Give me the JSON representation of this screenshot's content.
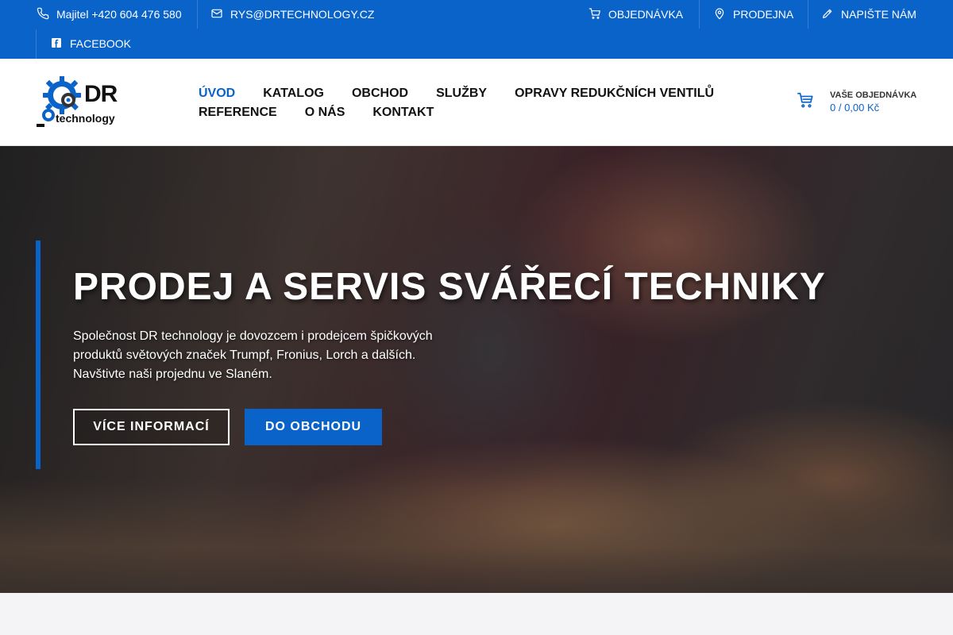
{
  "topbar": {
    "phone": "Majitel +420 604 476 580",
    "email": "RYS@DRTECHNOLOGY.CZ",
    "order": "OBJEDNÁVKA",
    "store": "PRODEJNA",
    "write": "NAPIŠTE NÁM",
    "facebook": "FACEBOOK"
  },
  "logo": {
    "dr": "DR",
    "technology": "technology"
  },
  "nav": {
    "row1": [
      "ÚVOD",
      "KATALOG",
      "OBCHOD",
      "SLUŽBY",
      "OPRAVY REDUKČNÍCH VENTILŮ"
    ],
    "row2": [
      "REFERENCE",
      "O NÁS",
      "KONTAKT"
    ]
  },
  "cart": {
    "title": "VAŠE OBJEDNÁVKA",
    "value": "0 / 0,00 Kč"
  },
  "hero": {
    "title": "PRODEJ A SERVIS SVÁŘECÍ TECHNIKY",
    "text": "Společnost DR technology je dovozcem i prodejcem špičkových produktů světových značek Trumpf, Fronius, Lorch a dalších. Navštivte naši projednu ve Slaném.",
    "btn_info": "VÍCE INFORMACÍ",
    "btn_shop": "DO OBCHODU"
  },
  "colors": {
    "accent": "#0a63c9"
  }
}
